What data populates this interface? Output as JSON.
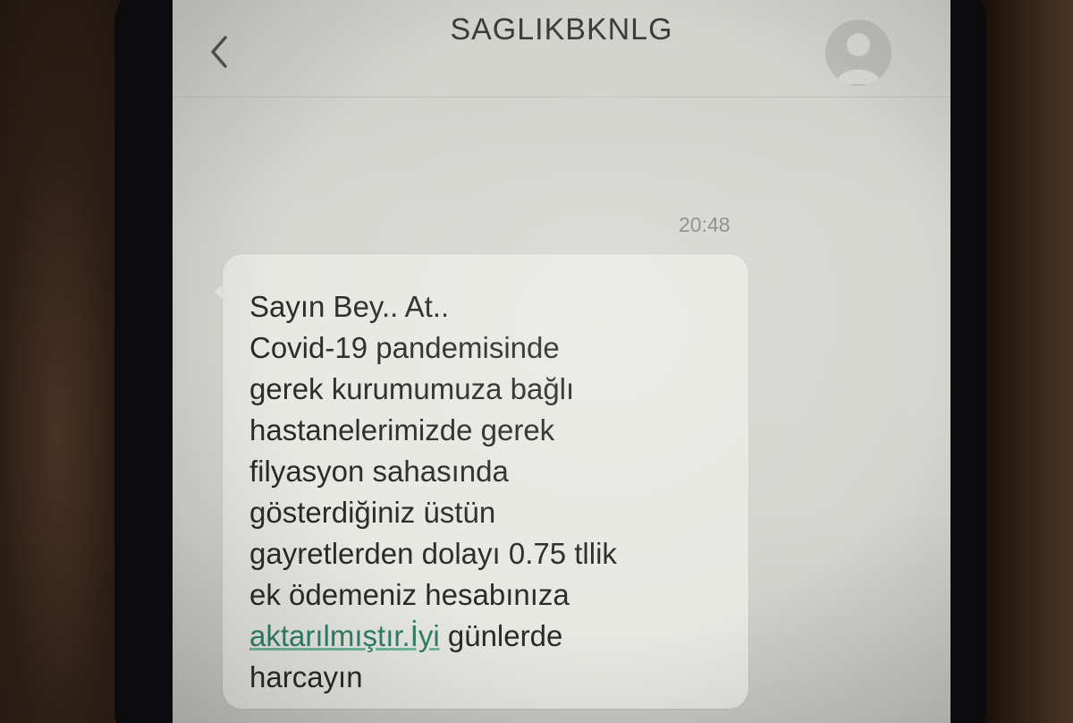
{
  "header": {
    "contact_name": "SAGLIKBKNLG"
  },
  "conversation": {
    "timestamp": "20:48",
    "message": {
      "line1": "Sayın Bey.. At..",
      "line2": "Covid-19 pandemisinde",
      "line3": "gerek kurumumuza bağlı",
      "line4": "hastanelerimizde gerek",
      "line5": "filyasyon sahasında",
      "line6": "gösterdiğiniz üstün",
      "line7": "gayretlerden dolayı 0.75 tllik",
      "line8": "ek ödemeniz hesabınıza",
      "link_text": "aktarılmıştır.İyi",
      "line9_rest": " günlerde",
      "line10": "harcayın"
    }
  },
  "icons": {
    "back": "chevron-left-icon",
    "avatar": "person-icon"
  },
  "colors": {
    "screen_bg": "#d6d6d1",
    "bubble_bg": "#e8e8e3",
    "link": "#2f7f6a",
    "text": "#2a2a2a"
  }
}
